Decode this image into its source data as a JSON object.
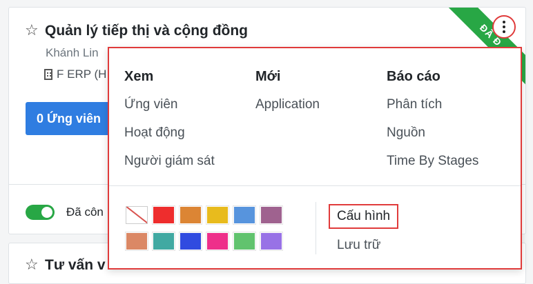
{
  "card1": {
    "title": "Quản lý tiếp thị và cộng đồng",
    "subtitle": "Khánh Lin",
    "company": "F ERP (H",
    "applicants_button": "0 Ứng viên",
    "ribbon": "ĐÃ Đ",
    "published_label": "Đã côn",
    "published_on": true
  },
  "card2": {
    "title": "Tư vấn v"
  },
  "dropdown": {
    "view": {
      "heading": "Xem",
      "items": [
        "Ứng viên",
        "Hoạt động",
        "Người giám sát"
      ]
    },
    "new": {
      "heading": "Mới",
      "items": [
        "Application"
      ]
    },
    "reports": {
      "heading": "Báo cáo",
      "items": [
        "Phân tích",
        "Nguồn",
        "Time By Stages"
      ]
    },
    "colors": [
      "none",
      "#ee2d2d",
      "#dc8534",
      "#e8bb1d",
      "#5794dd",
      "#9f628f",
      "#db8865",
      "#41a9a2",
      "#304be0",
      "#ee2f8a",
      "#61c36e",
      "#9872e6"
    ],
    "configure": "Cấu hình",
    "archive": "Lưu trữ"
  }
}
